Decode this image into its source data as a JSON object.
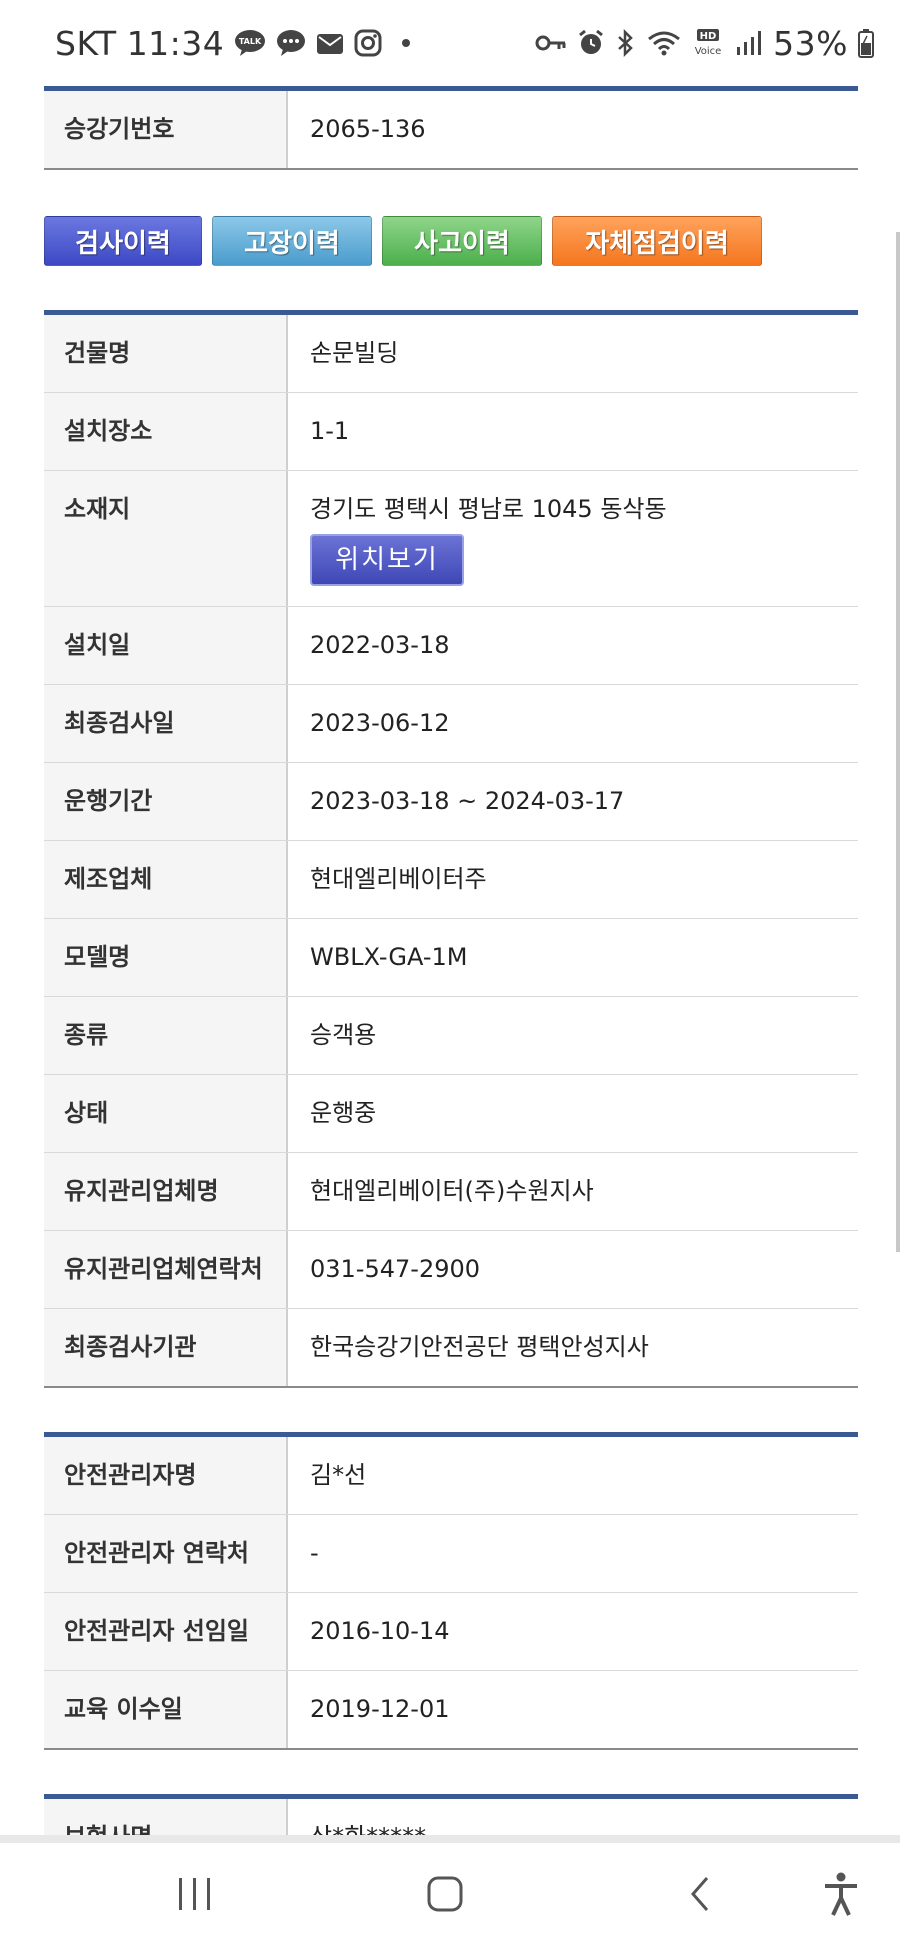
{
  "status_bar": {
    "carrier": "SKT",
    "time": "11:34",
    "battery": "53%",
    "left_icons": [
      "kakaotalk-icon",
      "chat-bubble-icon",
      "mail-icon",
      "instagram-icon"
    ],
    "right_icons": [
      "key-icon",
      "alarm-icon",
      "bluetooth-icon",
      "wifi-icon",
      "hd-voice-icon",
      "signal-icon",
      "battery-icon"
    ],
    "hd_voice_label": "HD Voice"
  },
  "top_table": {
    "rows": [
      {
        "label": "승강기번호",
        "value": "2065-136"
      }
    ]
  },
  "history_buttons": {
    "inspection": "검사이력",
    "fault": "고장이력",
    "accident": "사고이력",
    "self_inspection": "자체점검이력"
  },
  "building_table": {
    "building_name_label": "건물명",
    "building_name": "손문빌딩",
    "install_place_label": "설치장소",
    "install_place": "1-1",
    "address_label": "소재지",
    "address": "경기도 평택시 평남로 1045 동삭동",
    "location_button": "위치보기",
    "rows": [
      {
        "label": "설치일",
        "value": "2022-03-18"
      },
      {
        "label": "최종검사일",
        "value": "2023-06-12"
      },
      {
        "label": "운행기간",
        "value": "2023-03-18 ~ 2024-03-17"
      },
      {
        "label": "제조업체",
        "value": "현대엘리베이터주"
      },
      {
        "label": "모델명",
        "value": "WBLX-GA-1M"
      },
      {
        "label": "종류",
        "value": "승객용"
      },
      {
        "label": "상태",
        "value": "운행중"
      },
      {
        "label": "유지관리업체명",
        "value": "현대엘리베이터(주)수원지사"
      },
      {
        "label": "유지관리업체연락처",
        "value": "031-547-2900"
      },
      {
        "label": "최종검사기관",
        "value": "한국승강기안전공단 평택안성지사"
      }
    ]
  },
  "safety_table": {
    "rows": [
      {
        "label": "안전관리자명",
        "value": "김*선"
      },
      {
        "label": "안전관리자 연락처",
        "value": "-"
      },
      {
        "label": "안전관리자 선임일",
        "value": "2016-10-14"
      },
      {
        "label": "교육 이수일",
        "value": "2019-12-01"
      }
    ]
  },
  "insurance_table": {
    "rows": [
      {
        "label": "보험사명",
        "value": "삼*화*****"
      }
    ]
  },
  "colors": {
    "table_top_border": "#3b5a94",
    "inspection_button": "#4a56cf",
    "fault_button": "#5ba7d4",
    "accident_button": "#5cb85c",
    "self_inspection_button": "#f7852e",
    "location_button": "#4a52c0"
  },
  "nav_bar": {
    "icons": [
      "recent-apps-icon",
      "home-icon",
      "back-icon",
      "accessibility-icon"
    ]
  }
}
